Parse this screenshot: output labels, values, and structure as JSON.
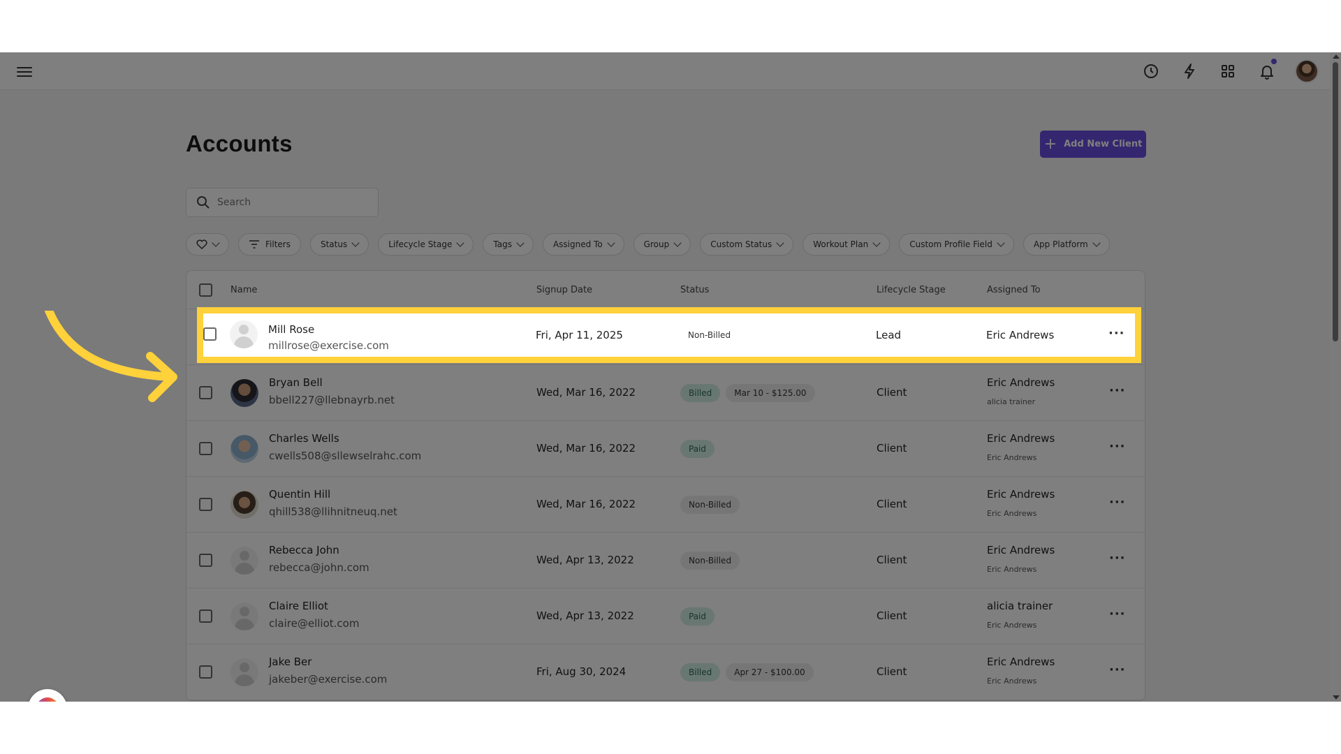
{
  "page": {
    "title": "Accounts",
    "add_button": "Add New Client"
  },
  "search": {
    "placeholder": "Search"
  },
  "filters": [
    "Filters",
    "Status",
    "Lifecycle Stage",
    "Tags",
    "Assigned To",
    "Group",
    "Custom Status",
    "Workout Plan",
    "Custom Profile Field",
    "App Platform"
  ],
  "table": {
    "headers": {
      "name": "Name",
      "signup": "Signup Date",
      "status": "Status",
      "lifecycle": "Lifecycle Stage",
      "assigned": "Assigned To"
    },
    "rows": [
      {
        "name": "Mill Rose",
        "email": "millrose@exercise.com",
        "date": "Fri, Apr 11, 2025",
        "status": "Non-Billed",
        "amount": "",
        "lifecycle": "Lead",
        "assigned": "Eric Andrews",
        "sub": "",
        "avatar": "default"
      },
      {
        "name": "Bryan Bell",
        "email": "bbell227@llebnayrb.net",
        "date": "Wed, Mar 16, 2022",
        "status": "Billed",
        "amount": "Mar 10 - $125.00",
        "lifecycle": "Client",
        "assigned": "Eric Andrews",
        "sub": "alicia trainer",
        "avatar": "photo1"
      },
      {
        "name": "Charles Wells",
        "email": "cwells508@sllewselrahc.com",
        "date": "Wed, Mar 16, 2022",
        "status": "Paid",
        "amount": "",
        "lifecycle": "Client",
        "assigned": "Eric Andrews",
        "sub": "Eric Andrews",
        "avatar": "photo2"
      },
      {
        "name": "Quentin Hill",
        "email": "qhill538@llihnitneuq.net",
        "date": "Wed, Mar 16, 2022",
        "status": "Non-Billed",
        "amount": "",
        "lifecycle": "Client",
        "assigned": "Eric Andrews",
        "sub": "Eric Andrews",
        "avatar": "photo3"
      },
      {
        "name": "Rebecca John",
        "email": "rebecca@john.com",
        "date": "Wed, Apr 13, 2022",
        "status": "Non-Billed",
        "amount": "",
        "lifecycle": "Client",
        "assigned": "Eric Andrews",
        "sub": "Eric Andrews",
        "avatar": "default"
      },
      {
        "name": "Claire Elliot",
        "email": "claire@elliot.com",
        "date": "Wed, Apr 13, 2022",
        "status": "Paid",
        "amount": "",
        "lifecycle": "Client",
        "assigned": "alicia trainer",
        "sub": "Eric Andrews",
        "avatar": "default"
      },
      {
        "name": "Jake Ber",
        "email": "jakeber@exercise.com",
        "date": "Fri, Aug 30, 2024",
        "status": "Billed",
        "amount": "Apr 27 - $100.00",
        "lifecycle": "Client",
        "assigned": "Eric Andrews",
        "sub": "Eric Andrews",
        "avatar": "default"
      }
    ]
  },
  "more_label": "···",
  "assistant": {
    "count": "1"
  },
  "colors": {
    "accent": "#6a4de1",
    "highlight": "#ffd13a",
    "billed_bg": "#d3efe5"
  },
  "icons": [
    "menu-icon",
    "clock-icon",
    "bolt-icon",
    "apps-grid-icon",
    "bell-icon",
    "search-icon",
    "heart-icon",
    "filter-icon",
    "plus-icon"
  ]
}
